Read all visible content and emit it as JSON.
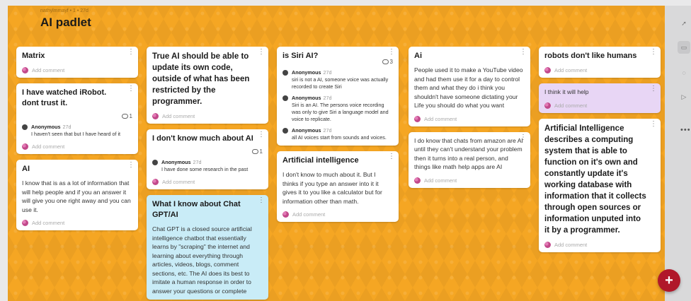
{
  "board": {
    "meta": "nathylmmayf • 1 • 27d",
    "title": "AI padlet"
  },
  "add_comment": "Add comment",
  "columns": [
    {
      "cards": [
        {
          "title": "Matrix"
        },
        {
          "title": "I have watched iRobot. dont trust it.",
          "comment_count": "1",
          "comments": [
            {
              "author": "Anonymous",
              "age": "27d",
              "text": "I haven't seen that but I have heard of it"
            }
          ]
        },
        {
          "title": "AI",
          "body": "I know that is as a lot of information that will help people and if you an answer it will give you one right away and you can use it."
        }
      ]
    },
    {
      "cards": [
        {
          "title": "True AI should be able to update its own code, outside of what has been restricted by the programmer."
        },
        {
          "title": "I don't know much about AI",
          "comment_count": "1",
          "comments": [
            {
              "author": "Anonymous",
              "age": "27d",
              "text": "I have done some research in the past"
            }
          ]
        },
        {
          "title": "What I know about Chat GPT/AI",
          "body": "Chat GPT is a closed source artificial intelligence chatbot that essentially learns by \"scraping\" the internet and learning about everything through articles, videos, blogs, comment sections, etc. The AI does its best to imitate a human response in order to answer your questions or complete"
        }
      ]
    },
    {
      "cards": [
        {
          "title": "is Siri AI?",
          "comment_count": "3",
          "comments": [
            {
              "author": "Anonymous",
              "age": "27d",
              "text": "siri is not a AI, someone voice was actually recorded to create Siri"
            },
            {
              "author": "Anonymous",
              "age": "27d",
              "text": "Siri is an AI. The persons voice recording was only to give Siri a language model and voice to replicate."
            },
            {
              "author": "Anonymous",
              "age": "27d",
              "text": "all AI voices start from sounds and voices."
            }
          ]
        },
        {
          "title": "Artificial intelligence",
          "body": "I don't know to much about it. But I thinks if you type an answer into it it gives it to you like a calculator but for information other than math."
        }
      ]
    },
    {
      "cards": [
        {
          "title": "Ai",
          "body": "People used it to make a YouTube video and had them use it for a day to control them and what they do i think you shouldn't have someone dictating your Life you should do what you want"
        },
        {
          "body": "I do know that chats from amazon are AI until they can't understand your problem then it turns into a real person, and things like math help apps are AI"
        }
      ]
    },
    {
      "cards": [
        {
          "title": "robots don't like humans"
        },
        {
          "body": "I think it will help"
        },
        {
          "title": "Artificial Intelligence describes a computing system that is able to function on it's own and constantly update it's working database with information that it collects through open sources or information unputed into it by a programmer."
        }
      ]
    }
  ],
  "sidebar": {
    "more": "•••"
  },
  "fab": {
    "label": "+"
  },
  "colors": {
    "board": "#f5a623",
    "fab": "#b0182a",
    "blue_card": "#c9ecf7",
    "purple_card": "#e8d6f5"
  }
}
